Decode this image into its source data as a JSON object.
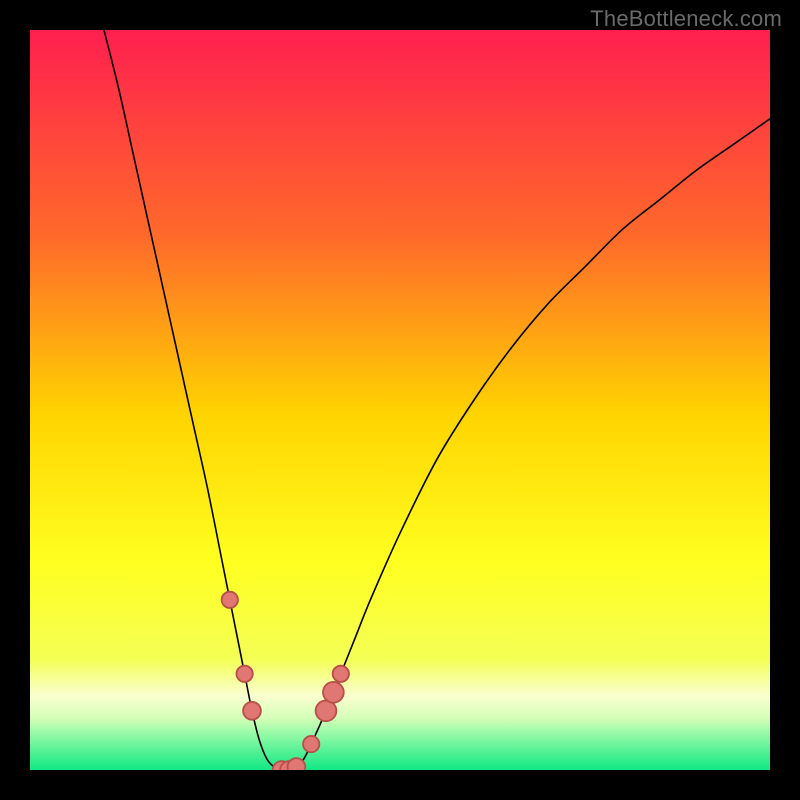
{
  "watermark": "TheBottleneck.com",
  "colors": {
    "bg": "#000000",
    "gradient_top": "#ff1f4f",
    "gradient_mid_upper": "#ff7a2a",
    "gradient_mid": "#ffd400",
    "gradient_mid_lower": "#ffff3a",
    "gradient_lower": "#e8ff6a",
    "gradient_band_light": "#f5ffc0",
    "gradient_bottom": "#10e884",
    "curve": "#000000",
    "marker_fill": "#e07772",
    "marker_stroke": "#b94f49"
  },
  "chart_data": {
    "type": "line",
    "title": "",
    "xlabel": "",
    "ylabel": "",
    "xlim": [
      0,
      100
    ],
    "ylim": [
      0,
      100
    ],
    "x": [
      10,
      12,
      14,
      16,
      18,
      20,
      22,
      24,
      26,
      27,
      28,
      29,
      30,
      31,
      32,
      33,
      34,
      35,
      36,
      37,
      38,
      40,
      42,
      44,
      46,
      50,
      55,
      60,
      65,
      70,
      75,
      80,
      85,
      90,
      95,
      100
    ],
    "values": [
      100,
      92,
      83,
      74,
      65,
      56,
      47,
      38,
      28,
      23,
      18,
      13,
      8,
      4,
      1.5,
      0.4,
      0,
      0,
      0.4,
      1.5,
      3.5,
      8,
      13,
      18,
      23,
      32,
      42,
      50,
      57,
      63,
      68,
      73,
      77,
      81,
      84.5,
      88
    ],
    "optimum_x": 34,
    "markers": [
      {
        "x": 27,
        "y": 23,
        "r": 1.1
      },
      {
        "x": 29,
        "y": 13,
        "r": 1.1
      },
      {
        "x": 30,
        "y": 8,
        "r": 1.2
      },
      {
        "x": 34,
        "y": 0,
        "r": 1.2
      },
      {
        "x": 35,
        "y": 0,
        "r": 1.2
      },
      {
        "x": 36,
        "y": 0.4,
        "r": 1.2
      },
      {
        "x": 38,
        "y": 3.5,
        "r": 1.1
      },
      {
        "x": 40,
        "y": 8,
        "r": 1.4
      },
      {
        "x": 41,
        "y": 10.5,
        "r": 1.4
      },
      {
        "x": 42,
        "y": 13,
        "r": 1.1
      }
    ]
  }
}
